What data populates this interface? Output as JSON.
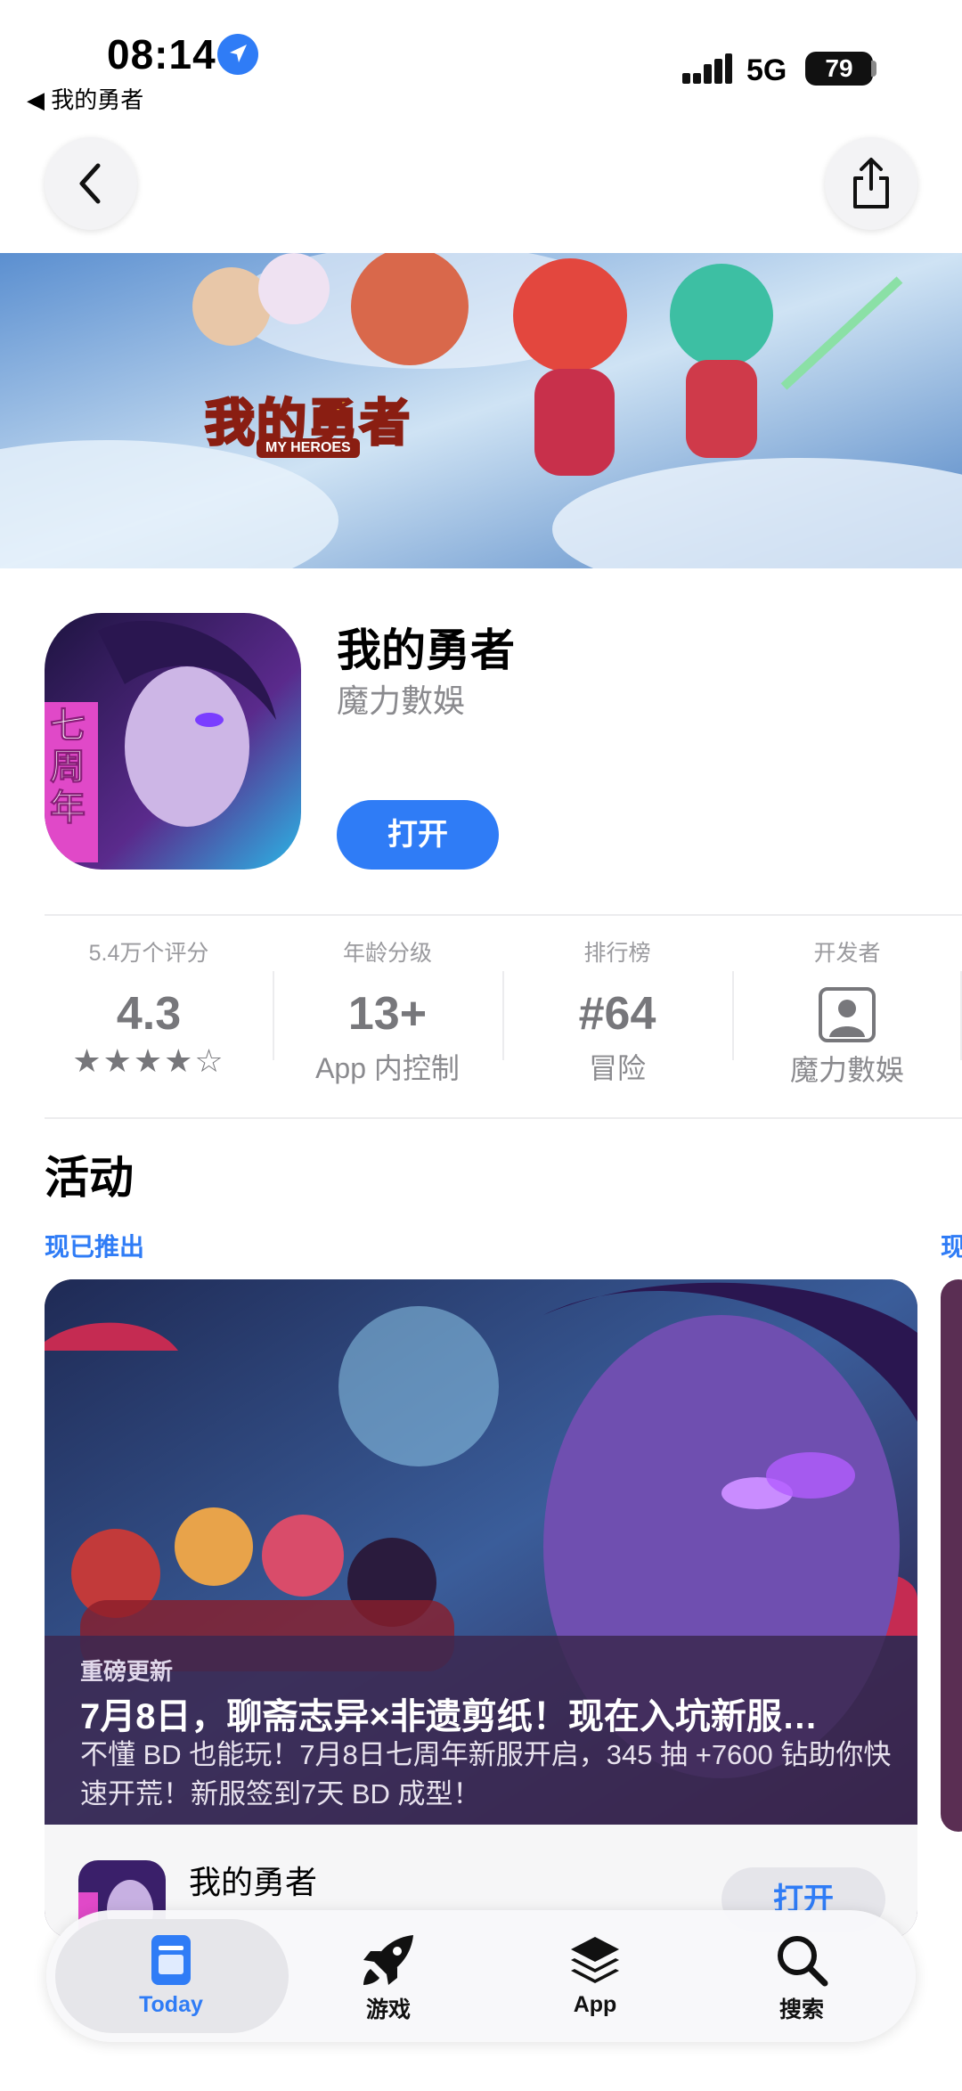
{
  "status_bar": {
    "time": "08:14",
    "back_app": "◀ 我的勇者",
    "network": "5G",
    "battery": "79"
  },
  "app": {
    "name": "我的勇者",
    "developer": "魔力數娛",
    "open_label": "打开",
    "banner_logo": "我的勇者",
    "banner_logo_sub": "MY HEROES",
    "icon_badge": "七周年"
  },
  "stats": [
    {
      "label": "5.4万个评分",
      "value": "4.3",
      "sub": "★★★★☆"
    },
    {
      "label": "年龄分级",
      "value": "13+",
      "sub": "App 内控制"
    },
    {
      "label": "排行榜",
      "value": "#64",
      "sub": "冒险"
    },
    {
      "label": "开发者",
      "value": "",
      "sub": "魔力數娛"
    }
  ],
  "events": {
    "section_title": "活动",
    "status": "现已推出",
    "status_next": "现",
    "card": {
      "tag": "重磅更新",
      "title": "7月8日，聊斋志异×非遗剪纸！现在入坑新服…",
      "description": "不懂 BD 也能玩！7月8日七周年新服开启，345 抽 +7600 钻助你快速开荒！新服签到7天 BD 成型！",
      "app_name": "我的勇者",
      "open_label": "打开"
    }
  },
  "tabbar": {
    "tabs": [
      {
        "label": "Today",
        "icon": "today-icon",
        "active": true
      },
      {
        "label": "游戏",
        "icon": "rocket-icon",
        "active": false
      },
      {
        "label": "App",
        "icon": "layers-icon",
        "active": false
      },
      {
        "label": "搜索",
        "icon": "search-icon",
        "active": false
      }
    ]
  },
  "colors": {
    "accent": "#2f7cf6",
    "text_secondary": "#8a8a8e",
    "card_bg": "#4c3a5e"
  }
}
